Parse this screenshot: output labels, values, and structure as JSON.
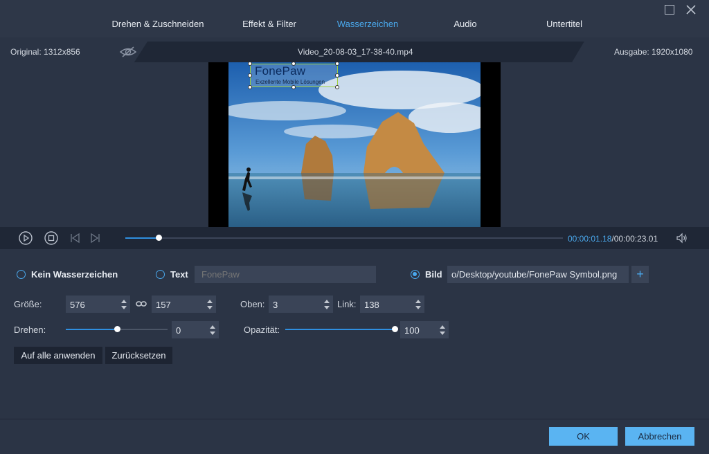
{
  "tabs": [
    {
      "label": "Drehen & Zuschneiden",
      "active": false
    },
    {
      "label": "Effekt & Filter",
      "active": false
    },
    {
      "label": "Wasserzeichen",
      "active": true
    },
    {
      "label": "Audio",
      "active": false
    },
    {
      "label": "Untertitel",
      "active": false
    }
  ],
  "info": {
    "original": "Original: 1312x856",
    "filename": "Video_20-08-03_17-38-40.mp4",
    "output": "Ausgabe: 1920x1080"
  },
  "preview": {
    "watermark_title": "FonePaw",
    "watermark_subtitle": "Exzellente Mobile Lösungen"
  },
  "player": {
    "current_time": "00:00:01.18",
    "separator": "/",
    "total_time": "00:00:23.01",
    "progress_fraction": 0.076
  },
  "watermark": {
    "none_label": "Kein Wasserzeichen",
    "text_label": "Text",
    "text_placeholder": "FonePaw",
    "image_label": "Bild",
    "image_path": "o/Desktop/youtube/FonePaw Symbol.png",
    "plus_label": "+",
    "selected": "image"
  },
  "settings": {
    "size_label": "Größe:",
    "width": "576",
    "height": "157",
    "top_label": "Oben:",
    "top": "3",
    "left_label": "Link:",
    "left": "138",
    "rotate_label": "Drehen:",
    "rotate": "0",
    "rotate_fraction": 0.5,
    "opacity_label": "Opazität:",
    "opacity": "100",
    "opacity_fraction": 1.0,
    "apply_all": "Auf alle anwenden",
    "reset": "Zurücksetzen"
  },
  "footer": {
    "ok": "OK",
    "cancel": "Abbrechen"
  },
  "colors": {
    "accent": "#4aa8ec",
    "background": "#2b3445",
    "panel_dark": "#1f2736",
    "button_blue": "#5ab4f2"
  }
}
